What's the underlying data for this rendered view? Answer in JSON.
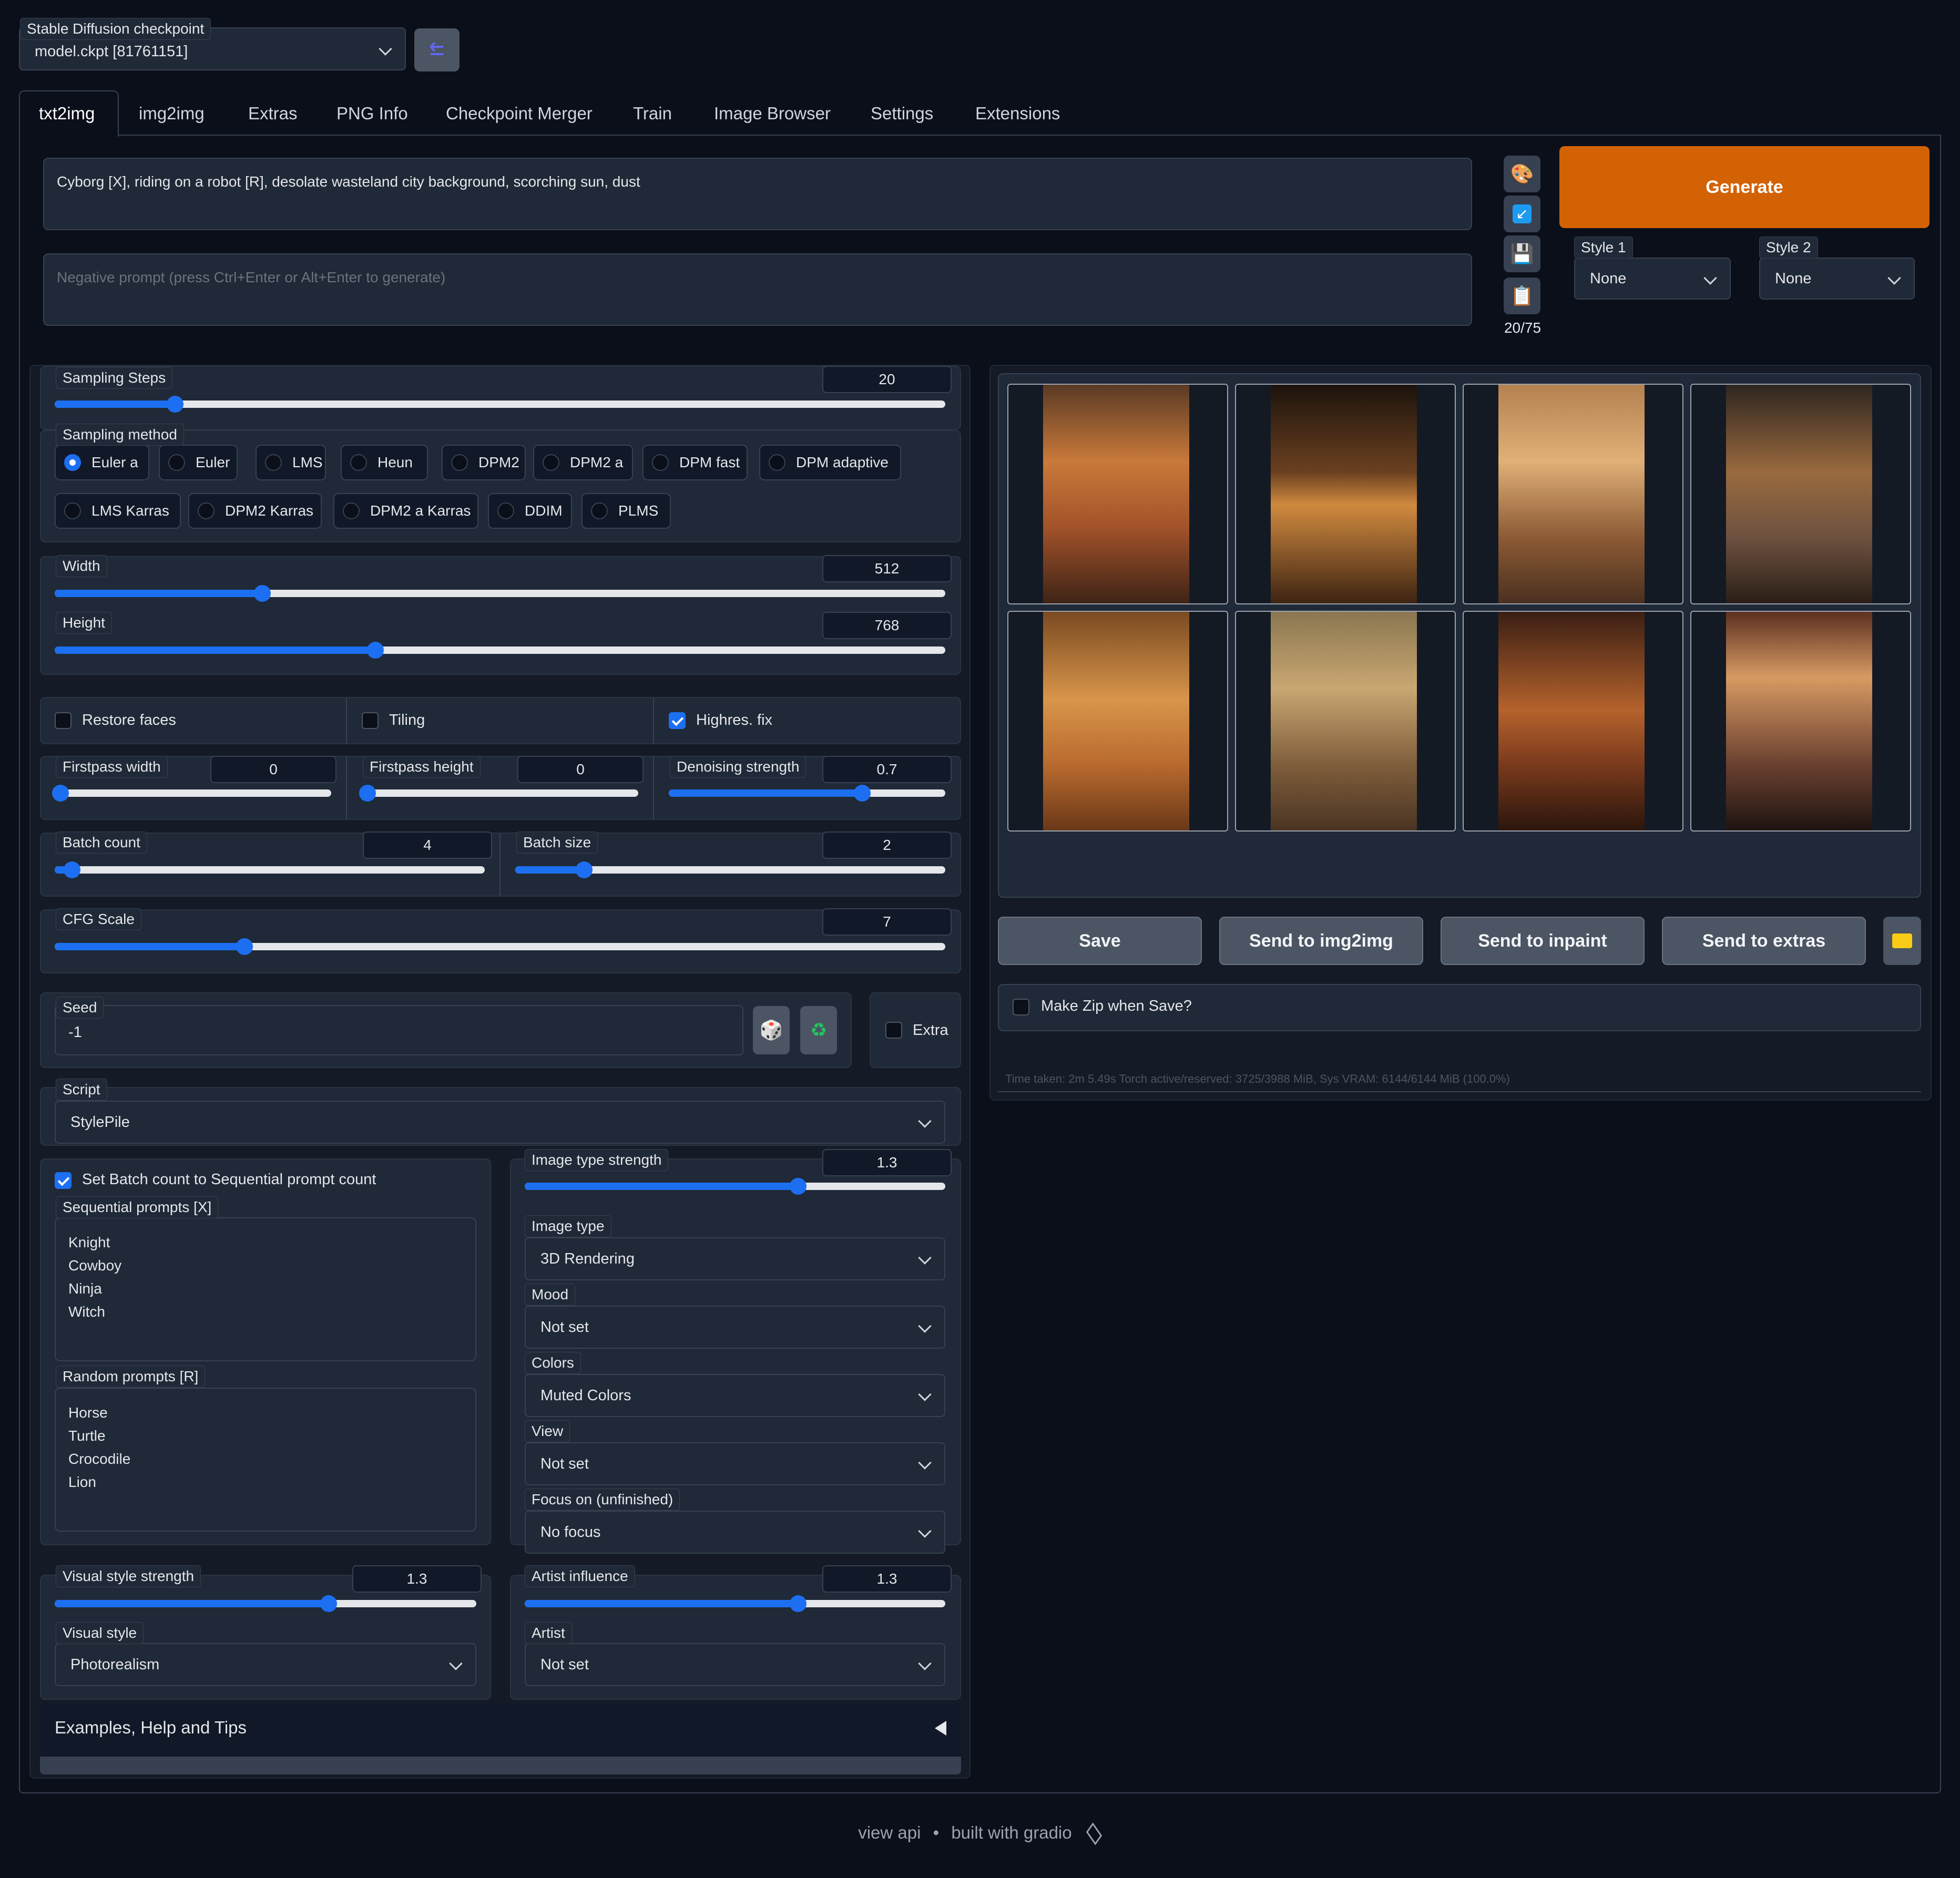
{
  "checkpoint": {
    "label": "Stable Diffusion checkpoint",
    "value": "model.ckpt [81761151]"
  },
  "tabs": [
    "txt2img",
    "img2img",
    "Extras",
    "PNG Info",
    "Checkpoint Merger",
    "Train",
    "Image Browser",
    "Settings",
    "Extensions"
  ],
  "prompt": {
    "value": "Cyborg [X], riding on a robot [R], desolate wasteland city background, scorching sun, dust",
    "negative_placeholder": "Negative prompt (press Ctrl+Enter or Alt+Enter to generate)",
    "token_count": "20/75"
  },
  "generate_label": "Generate",
  "styles": {
    "style1_label": "Style 1",
    "style1_value": "None",
    "style2_label": "Style 2",
    "style2_value": "None"
  },
  "sampling": {
    "steps_label": "Sampling Steps",
    "steps": "20",
    "steps_frac": 0.135,
    "method_label": "Sampling method",
    "methods": [
      "Euler a",
      "Euler",
      "LMS",
      "Heun",
      "DPM2",
      "DPM2 a",
      "DPM fast",
      "DPM adaptive",
      "LMS Karras",
      "DPM2 Karras",
      "DPM2 a Karras",
      "DDIM",
      "PLMS"
    ],
    "selected": "Euler a"
  },
  "size": {
    "width_label": "Width",
    "width": "512",
    "width_frac": 0.233,
    "height_label": "Height",
    "height": "768",
    "height_frac": 0.36
  },
  "options": {
    "restore_faces": "Restore faces",
    "tiling": "Tiling",
    "highres": "Highres. fix",
    "highres_checked": true
  },
  "firstpass": {
    "width_label": "Firstpass width",
    "width": "0",
    "height_label": "Firstpass height",
    "height": "0",
    "denoise_label": "Denoising strength",
    "denoise": "0.7",
    "denoise_frac": 0.7
  },
  "batch": {
    "count_label": "Batch count",
    "count": "4",
    "count_frac": 0.04,
    "size_label": "Batch size",
    "size": "2",
    "size_frac": 0.16
  },
  "cfg": {
    "label": "CFG Scale",
    "value": "7",
    "frac": 0.213
  },
  "seed": {
    "label": "Seed",
    "value": "-1",
    "extra_label": "Extra",
    "dice_icon": "dice-icon",
    "recycle_icon": "recycle-icon"
  },
  "script": {
    "label": "Script",
    "value": "StylePile"
  },
  "stylepile": {
    "batch_seq_label": "Set Batch count to Sequential prompt count",
    "seq_label": "Sequential prompts [X]",
    "seq_lines": [
      "Knight",
      "Cowboy",
      "Ninja",
      "Witch"
    ],
    "rand_label": "Random prompts [R]",
    "rand_lines": [
      "Horse",
      "Turtle",
      "Crocodile",
      "Lion"
    ],
    "image_type_strength_label": "Image type strength",
    "image_type_strength": "1.3",
    "image_type_strength_frac": 0.65,
    "image_type_label": "Image type",
    "image_type": "3D Rendering",
    "mood_label": "Mood",
    "mood": "Not set",
    "colors_label": "Colors",
    "colors": "Muted Colors",
    "view_label": "View",
    "view": "Not set",
    "focus_label": "Focus on (unfinished)",
    "focus": "No focus",
    "visual_strength_label": "Visual style strength",
    "visual_strength": "1.3",
    "visual_strength_frac": 0.65,
    "visual_style_label": "Visual style",
    "visual_style": "Photorealism",
    "artist_influence_label": "Artist influence",
    "artist_influence": "1.3",
    "artist_influence_frac": 0.65,
    "artist_label": "Artist",
    "artist": "Not set"
  },
  "accordion": {
    "label": "Examples, Help and Tips"
  },
  "output": {
    "buttons": [
      "Save",
      "Send to img2img",
      "Send to inpaint",
      "Send to extras"
    ],
    "zip_label": "Make Zip when Save?",
    "time_text": "Time taken: 2m 5.49s  Torch active/reserved: 3725/3988 MiB, Sys VRAM: 6144/6144 MiB (100.0%)"
  },
  "footer": {
    "api": "view api",
    "sep": "•",
    "built": "built with gradio"
  },
  "colors": {
    "accent": "#1d6ff2",
    "generate": "#d36205",
    "bg": "#0b0f19"
  }
}
